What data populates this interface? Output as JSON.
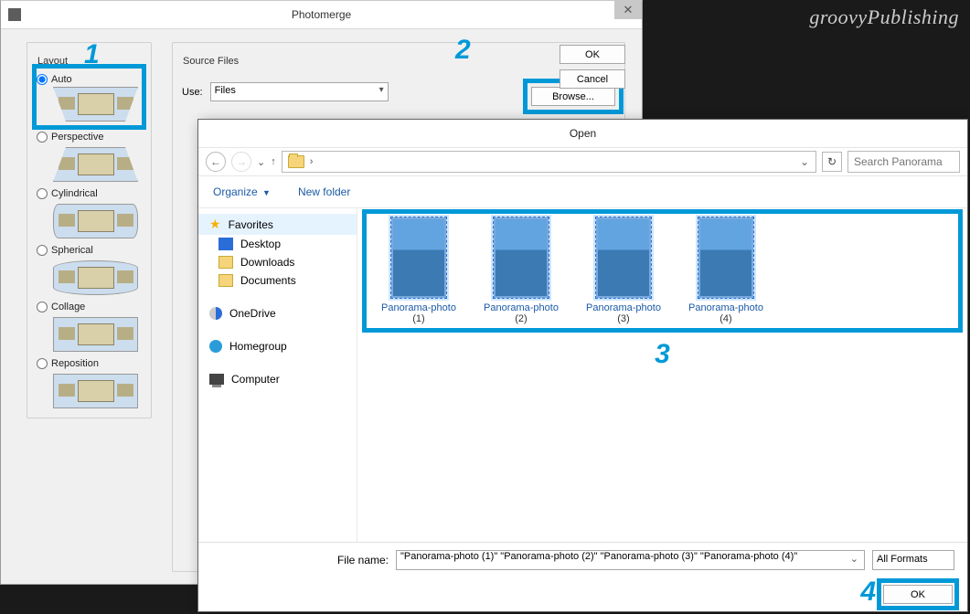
{
  "watermark": "groovyPublishing",
  "photomerge": {
    "title": "Photomerge",
    "layout_legend": "Layout",
    "options": [
      "Auto",
      "Perspective",
      "Cylindrical",
      "Spherical",
      "Collage",
      "Reposition"
    ],
    "selected": "Auto",
    "source_legend": "Source Files",
    "use_label": "Use:",
    "use_value": "Files",
    "browse": "Browse...",
    "ok": "OK",
    "cancel": "Cancel"
  },
  "open": {
    "title": "Open",
    "addr_chevron": "›",
    "addr_down": "⌄",
    "search_placeholder": "Search Panorama",
    "organize": "Organize",
    "new_folder": "New folder",
    "sidebar": {
      "favorites": "Favorites",
      "desktop": "Desktop",
      "downloads": "Downloads",
      "documents": "Documents",
      "onedrive": "OneDrive",
      "homegroup": "Homegroup",
      "computer": "Computer"
    },
    "files": [
      {
        "name": "Panorama-photo",
        "num": "(1)"
      },
      {
        "name": "Panorama-photo",
        "num": "(2)"
      },
      {
        "name": "Panorama-photo",
        "num": "(3)"
      },
      {
        "name": "Panorama-photo",
        "num": "(4)"
      }
    ],
    "filename_label": "File name:",
    "filename_value": "\"Panorama-photo (1)\" \"Panorama-photo (2)\" \"Panorama-photo (3)\" \"Panorama-photo (4)\"",
    "formats": "All Formats",
    "ok": "OK"
  },
  "steps": {
    "s1": "1",
    "s2": "2",
    "s3": "3",
    "s4": "4"
  }
}
